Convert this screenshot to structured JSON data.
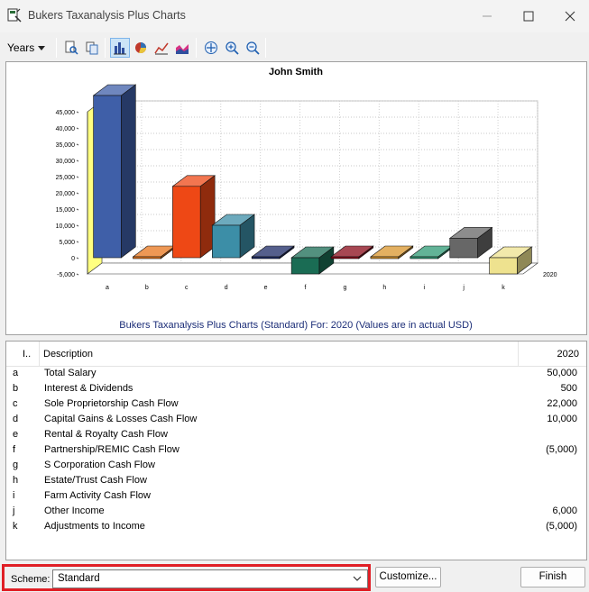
{
  "window": {
    "title": "Bukers Taxanalysis Plus Charts"
  },
  "toolbar": {
    "years_label": "Years",
    "icons": [
      "print-preview-icon",
      "copy-icon",
      "bar-chart-icon",
      "pie-chart-icon",
      "line-chart-icon",
      "area-chart-icon",
      "move-icon",
      "zoom-in-icon",
      "zoom-out-icon"
    ]
  },
  "chart_data": {
    "type": "bar",
    "title": "John Smith",
    "subtitle": "Bukers Taxanalysis Plus Charts (Standard)  For: 2020 (Values are in actual USD)",
    "categories": [
      "a",
      "b",
      "c",
      "d",
      "e",
      "f",
      "g",
      "h",
      "i",
      "j",
      "k"
    ],
    "series": [
      {
        "name": "2020",
        "values": [
          50000,
          500,
          22000,
          10000,
          0,
          -5000,
          0,
          0,
          0,
          6000,
          -5000
        ]
      }
    ],
    "yticks": [
      "-5,000",
      "0",
      "5,000",
      "10,000",
      "15,000",
      "20,000",
      "25,000",
      "30,000",
      "35,000",
      "40,000",
      "45,000"
    ],
    "ylim": [
      -5000,
      45000
    ],
    "grid": true,
    "colors": [
      "#3f5fa8",
      "#e8761c",
      "#ee4815",
      "#3c8ea7",
      "#1c2a66",
      "#1a6c54",
      "#8a0a18",
      "#d9952c",
      "#2e9a74",
      "#676767",
      "#eee28f"
    ]
  },
  "grid": {
    "col_id": "I..",
    "col_desc": "Description",
    "col_year": "2020",
    "rows": [
      {
        "id": "a",
        "desc": "Total Salary",
        "value": "50,000"
      },
      {
        "id": "b",
        "desc": "Interest & Dividends",
        "value": "500"
      },
      {
        "id": "c",
        "desc": "Sole Proprietorship Cash Flow",
        "value": "22,000"
      },
      {
        "id": "d",
        "desc": "Capital Gains & Losses Cash Flow",
        "value": "10,000"
      },
      {
        "id": "e",
        "desc": "Rental & Royalty Cash Flow",
        "value": ""
      },
      {
        "id": "f",
        "desc": "Partnership/REMIC Cash Flow",
        "value": "(5,000)"
      },
      {
        "id": "g",
        "desc": "S Corporation Cash Flow",
        "value": ""
      },
      {
        "id": "h",
        "desc": "Estate/Trust Cash Flow",
        "value": ""
      },
      {
        "id": "i",
        "desc": "Farm Activity Cash Flow",
        "value": ""
      },
      {
        "id": "j",
        "desc": "Other Income",
        "value": "6,000"
      },
      {
        "id": "k",
        "desc": "Adjustments to Income",
        "value": "(5,000)"
      }
    ]
  },
  "bottom": {
    "scheme_label": "Scheme:",
    "scheme_value": "Standard",
    "customize_label": "Customize...",
    "finish_label": "Finish"
  }
}
